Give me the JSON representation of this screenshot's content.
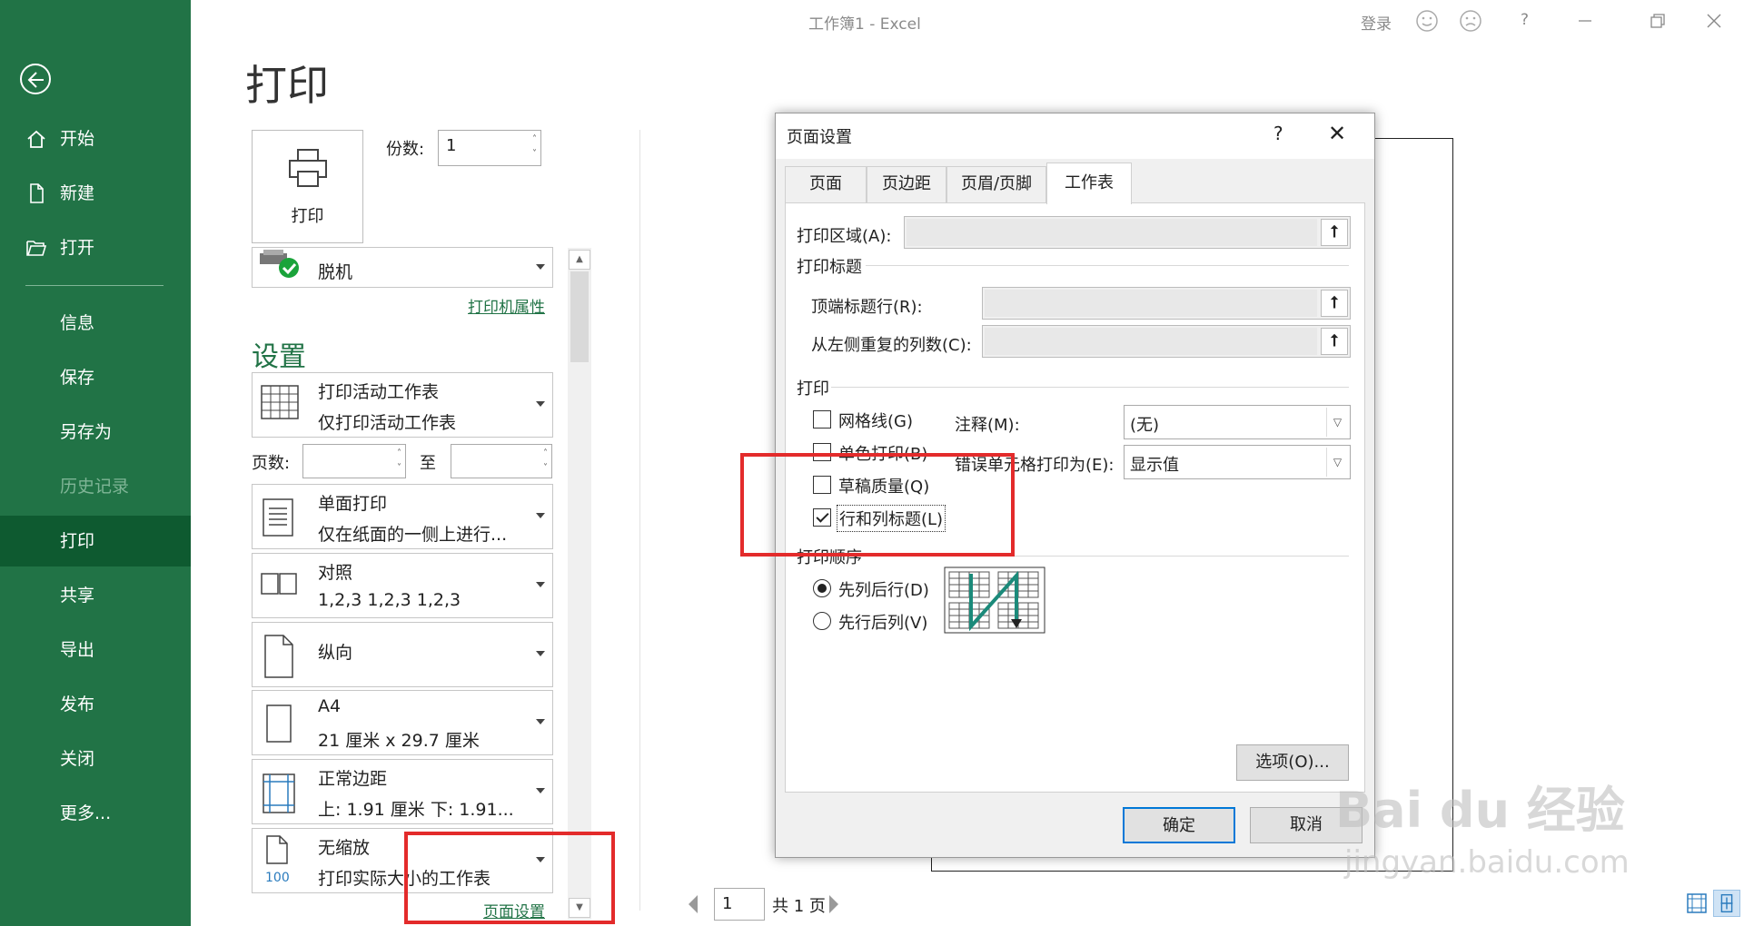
{
  "window": {
    "title": "工作簿1  -  Excel",
    "login": "登录",
    "help": "?"
  },
  "nav": {
    "items": [
      {
        "label": "开始"
      },
      {
        "label": "新建"
      },
      {
        "label": "打开"
      },
      {
        "label": "信息"
      },
      {
        "label": "保存"
      },
      {
        "label": "另存为"
      },
      {
        "label": "历史记录",
        "disabled": true
      },
      {
        "label": "打印",
        "active": true
      },
      {
        "label": "共享"
      },
      {
        "label": "导出"
      },
      {
        "label": "发布"
      },
      {
        "label": "关闭"
      },
      {
        "label": "更多..."
      }
    ]
  },
  "print": {
    "page_title": "打印",
    "print_button": "打印",
    "copies_label": "份数:",
    "copies_value": "1",
    "printer_status": "脱机",
    "printer_props_link": "打印机属性",
    "settings_title": "设置",
    "pages_label": "页数:",
    "to_label": "至",
    "options": [
      {
        "l1": "打印活动工作表",
        "l2": "仅打印活动工作表"
      },
      {
        "l1": "单面打印",
        "l2": "仅在纸面的一侧上进行..."
      },
      {
        "l1": "对照",
        "l2": "1,2,3     1,2,3     1,2,3"
      },
      {
        "l1": "纵向",
        "l2": ""
      },
      {
        "l1": "A4",
        "l2": "21 厘米 x 29.7 厘米"
      },
      {
        "l1": "正常边距",
        "l2": "上: 1.91 厘米 下: 1.91..."
      },
      {
        "l1": "无缩放",
        "l2": "打印实际大小的工作表"
      }
    ],
    "scale_badge": "100",
    "page_setup_link": "页面设置"
  },
  "preview": {
    "page_input": "1",
    "page_total": "共 1 页"
  },
  "dialog": {
    "title": "页面设置",
    "help": "?",
    "close": "✕",
    "tabs": [
      "页面",
      "页边距",
      "页眉/页脚",
      "工作表"
    ],
    "active_tab": "工作表",
    "print_area_label": "打印区域(A):",
    "print_titles_label": "打印标题",
    "top_rows_label": "顶端标题行(R):",
    "left_cols_label": "从左侧重复的列数(C):",
    "print_group_label": "打印",
    "checkboxes": [
      {
        "label": "网格线(G)",
        "checked": false
      },
      {
        "label": "单色打印(B)",
        "checked": false
      },
      {
        "label": "草稿质量(Q)",
        "checked": false
      },
      {
        "label": "行和列标题(L)",
        "checked": true
      }
    ],
    "comments_label": "注释(M):",
    "comments_value": "(无)",
    "errors_label": "错误单元格打印为(E):",
    "errors_value": "显示值",
    "page_order_label": "打印顺序",
    "radios": [
      {
        "label": "先列后行(D)",
        "checked": true
      },
      {
        "label": "先行后列(V)",
        "checked": false
      }
    ],
    "options_button": "选项(O)...",
    "ok_button": "确定",
    "cancel_button": "取消"
  },
  "watermark": {
    "brand": "Bai du 经验",
    "url": "jingyan.baidu.com"
  }
}
